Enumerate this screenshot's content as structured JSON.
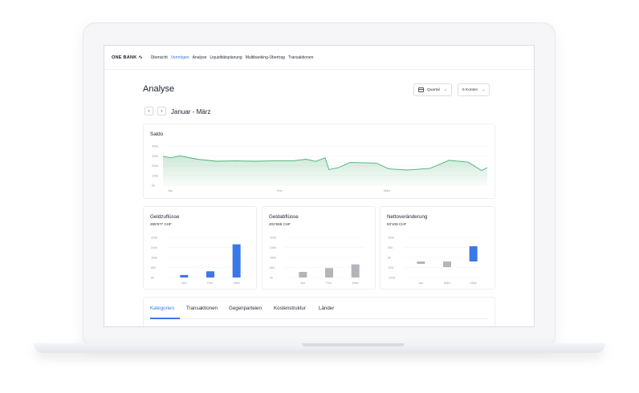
{
  "nav": {
    "brand": "ONE BANK",
    "items": [
      "Übersicht",
      "Vermögen",
      "Analyse",
      "Liquiditätsplanung",
      "Multibanking-Übertrag",
      "Transaktionen"
    ],
    "active_index": 1
  },
  "page": {
    "title": "Analyse",
    "period_button": "Quartal",
    "accounts_button": "5 Konten",
    "prev_label": "‹",
    "next_label": "›",
    "period": "Januar - März"
  },
  "icons": {
    "brand": "wave-logo-icon",
    "period_button": "calendar-icon",
    "dropdown": "chevron-down-icon",
    "prev": "chevron-left-icon",
    "next": "chevron-right-icon"
  },
  "colors": {
    "accent": "#3b78e7",
    "line": "#4caf74",
    "bar_gray": "#b3b5ba"
  },
  "tabs": [
    "Kategorien",
    "Transaktionen",
    "Gegenparteien",
    "Kostenstruktur",
    "Länder"
  ],
  "cards": {
    "saldo": {
      "title": "Saldo"
    },
    "inflow": {
      "title": "Geldzuflüsse",
      "sub": "285'977 CHF"
    },
    "outflow": {
      "title": "Geldabflüsse",
      "sub": "202'868 CHF"
    },
    "net": {
      "title": "Nettoveränderung",
      "sub": "83'109 CHF"
    }
  },
  "chart_data": [
    {
      "type": "area",
      "title": "Saldo",
      "x_ticks": [
        "Jan.",
        "Feb.",
        "März"
      ],
      "y_ticks": [
        "400k",
        "300k",
        "200k",
        "100k",
        "0k"
      ],
      "ylim": [
        0,
        400000
      ],
      "x": [
        0,
        4,
        9,
        18,
        28,
        38,
        48,
        58,
        68,
        75,
        80,
        85,
        87,
        92,
        98,
        107,
        112,
        118,
        120,
        128,
        140,
        150,
        160,
        167,
        170
      ],
      "values": [
        295000,
        280000,
        300000,
        265000,
        245000,
        248000,
        245000,
        248000,
        248000,
        265000,
        243000,
        280000,
        160000,
        180000,
        232000,
        228000,
        225000,
        170000,
        165000,
        155000,
        172000,
        255000,
        235000,
        150000,
        180000
      ]
    },
    {
      "type": "bar",
      "title": "Geldzuflüsse",
      "categories": [
        "Jan.",
        "Feb.",
        "März"
      ],
      "y_ticks": [
        "320k",
        "240k",
        "160k",
        "80k",
        "0k"
      ],
      "ylim": [
        0,
        320000
      ],
      "values": [
        20000,
        50000,
        265000
      ],
      "colors": [
        "#3b78e7",
        "#3b78e7",
        "#3b78e7"
      ]
    },
    {
      "type": "bar",
      "title": "Geldabflüsse",
      "categories": [
        "Jan.",
        "Feb.",
        "März"
      ],
      "y_ticks": [
        "320k",
        "240k",
        "160k",
        "80k",
        "0k"
      ],
      "ylim": [
        0,
        320000
      ],
      "values": [
        45000,
        75000,
        105000
      ],
      "colors": [
        "#b3b5ba",
        "#b3b5ba",
        "#b3b5ba"
      ]
    },
    {
      "type": "bar",
      "title": "Nettoveränderung",
      "categories": [
        "Jan.",
        "März",
        "März"
      ],
      "y_ticks": [
        "150k",
        "50k",
        "0k",
        "-50k",
        "-100k"
      ],
      "ylim": [
        -100000,
        150000
      ],
      "values": [
        -15000,
        -35000,
        95000
      ],
      "colors": [
        "#b3b5ba",
        "#b3b5ba",
        "#3b78e7"
      ]
    }
  ]
}
